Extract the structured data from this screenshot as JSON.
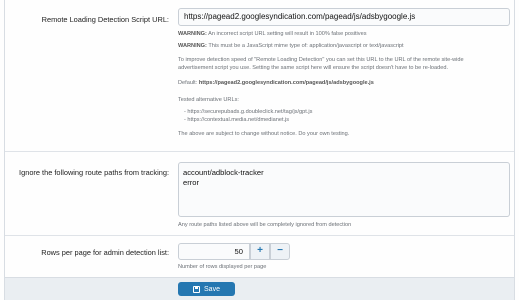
{
  "script_url": {
    "label": "Remote Loading Detection Script URL:",
    "value": "https://pagead2.googlesyndication.com/pagead/js/adsbygoogle.js",
    "warning1_strong": "WARNING:",
    "warning1_text": " An incorrect script URL setting will result in 100% false positives",
    "warning2_strong": "WARNING:",
    "warning2_text": " This must be a JavaScript mime type of: application/javascript or text/javascript",
    "para_line1": "To improve detection speed of \"Remote Loading Detection\" you can set this URL to the URL of the remote site-wide",
    "para_line2": "advertisement script you use. Setting the same script here will ensure the script doesn't have to be re-loaded.",
    "default_prefix": "Default: ",
    "default_value": "https://pagead2.googlesyndication.com/pagead/js/adsbygoogle.js",
    "tested_label": "Tested alternative URLs:",
    "alternatives": [
      "- https://securepubads.g.doubleclick.net/tag/js/gpt.js",
      "- https://contextual.media.net/dmedianet.js"
    ],
    "subject_note": "The above are subject to change without notice. Do your own testing."
  },
  "ignore_paths": {
    "label": "Ignore the following route paths from tracking:",
    "lines": [
      "account/adblock-tracker",
      "error"
    ],
    "hint": "Any route paths listed above will be completely ignored from detection"
  },
  "rows_per_page": {
    "label": "Rows per page for admin detection list:",
    "value": "50",
    "plus": "+",
    "minus": "−",
    "hint": "Number of rows displayed per page"
  },
  "footer": {
    "save_label": "Save"
  }
}
